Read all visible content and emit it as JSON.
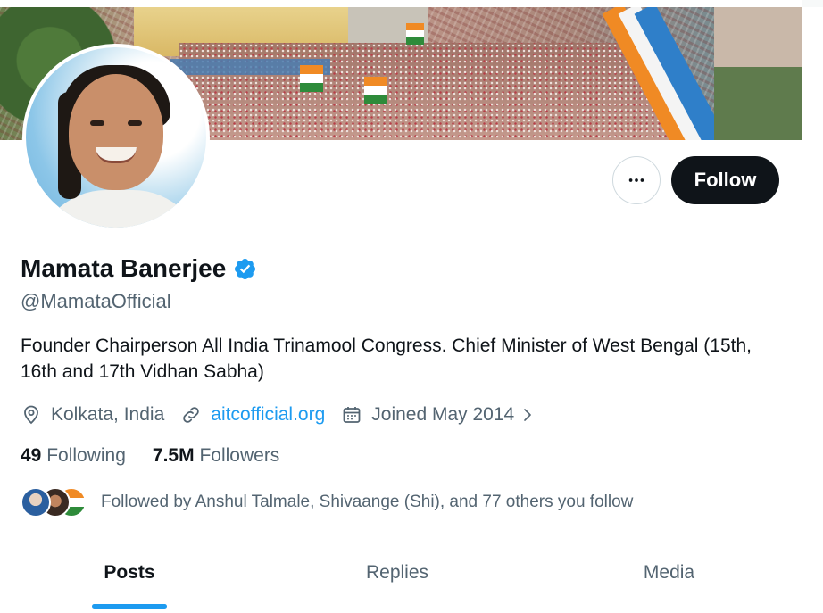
{
  "profile": {
    "display_name": "Mamata Banerjee",
    "handle": "@MamataOfficial",
    "verified": true,
    "bio": "Founder Chairperson All India Trinamool Congress. Chief Minister of West Bengal (15th, 16th and 17th Vidhan Sabha)",
    "location": "Kolkata, India",
    "website": "aitcofficial.org",
    "joined": "Joined May 2014"
  },
  "actions": {
    "more_icon": "more-horizontal-icon",
    "follow_label": "Follow"
  },
  "stats": {
    "following_count": "49",
    "following_label": "Following",
    "followers_count": "7.5M",
    "followers_label": "Followers"
  },
  "followed_by": {
    "text": "Followed by Anshul Talmale, Shivaange (Shi), and 77 others you follow"
  },
  "tabs": [
    {
      "label": "Posts",
      "active": true
    },
    {
      "label": "Replies",
      "active": false
    },
    {
      "label": "Media",
      "active": false
    }
  ],
  "colors": {
    "accent": "#1d9bf0",
    "text_primary": "#0f1419",
    "text_secondary": "#536471",
    "button_dark": "#0f1419"
  }
}
